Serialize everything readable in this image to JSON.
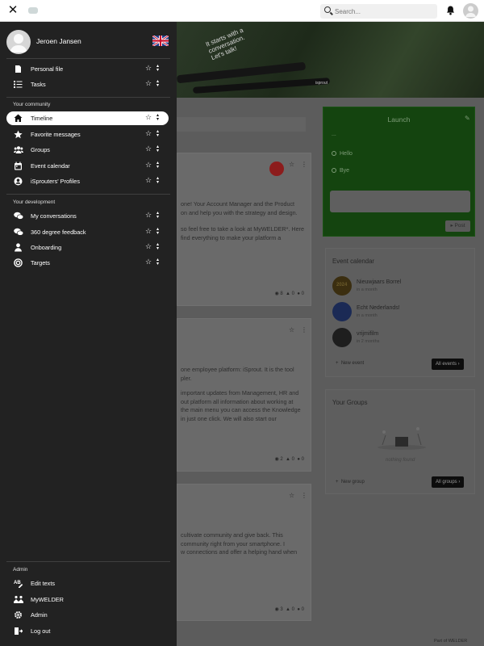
{
  "topbar": {
    "search_placeholder": "Search..."
  },
  "user": {
    "name": "Jeroen Jansen"
  },
  "nav_top": [
    {
      "label": "Personal file",
      "icon": "file-icon"
    },
    {
      "label": "Tasks",
      "icon": "tasks-icon"
    }
  ],
  "section_community": "Your community",
  "nav_community": [
    {
      "label": "Timeline",
      "icon": "home-icon",
      "active": true
    },
    {
      "label": "Favorite messages",
      "icon": "star-icon"
    },
    {
      "label": "Groups",
      "icon": "users-icon"
    },
    {
      "label": "Event calendar",
      "icon": "calendar-icon"
    },
    {
      "label": "iSprouters' Profiles",
      "icon": "profile-icon"
    }
  ],
  "section_development": "Your development",
  "nav_development": [
    {
      "label": "My conversations",
      "icon": "conversation-icon"
    },
    {
      "label": "360 degree feedback",
      "icon": "feedback-icon"
    },
    {
      "label": "Onboarding",
      "icon": "person-icon"
    },
    {
      "label": "Targets",
      "icon": "target-icon"
    }
  ],
  "section_admin": "Admin",
  "nav_admin": [
    {
      "label": "Edit texts",
      "icon": "edit-text-icon"
    },
    {
      "label": "MyWELDER",
      "icon": "welder-icon"
    },
    {
      "label": "Admin",
      "icon": "gear-icon"
    },
    {
      "label": "Log out",
      "icon": "logout-icon"
    }
  ],
  "hero": {
    "text_line1": "It starts with a",
    "text_line2": "conversation.",
    "text_line3": "Let's talk!",
    "brand": "isprout"
  },
  "feed": [
    {
      "lines": [
        "one! Your Account Manager and the Product",
        "on and help you with the strategy and design.",
        "",
        "so feel free to take a look at MyWELDER*. Here",
        "find everything to make your platform a"
      ],
      "views": "8",
      "likes": "0",
      "comments": "0"
    },
    {
      "lines": [
        "one employee platform: iSprout. It is the tool",
        "pler.",
        "",
        "important updates from Management, HR and",
        "out platform all information about working at",
        "the main menu you can access the Knowledge",
        "in just one click. We will also start our"
      ],
      "views": "2",
      "likes": "0",
      "comments": "0"
    },
    {
      "lines": [
        "cultivate community and give back. This",
        "community right from your smartphone. I",
        "w connections and offer a helping hand when"
      ],
      "views": "3",
      "likes": "0",
      "comments": "0"
    }
  ],
  "launch": {
    "title": "Launch",
    "dash": "...",
    "options": [
      "Hello",
      "Bye"
    ],
    "post_label": "Post"
  },
  "events": {
    "title": "Event calendar",
    "items": [
      {
        "name": "Nieuwjaars Borrel",
        "when": "in a month",
        "thumb_text": "2024"
      },
      {
        "name": "Echt Nederlands!",
        "when": "in a month",
        "thumb_text": ""
      },
      {
        "name": "vrijmifilm",
        "when": "in 2 months",
        "thumb_text": ""
      }
    ],
    "new_label": "New event",
    "all_label": "All events"
  },
  "groups": {
    "title": "Your Groups",
    "empty_label": "nothing found",
    "new_label": "New group",
    "all_label": "All groups"
  },
  "footer": {
    "text": "Part of WELDER"
  },
  "colors": {
    "drawer": "#222222",
    "launch_green": "#14440f",
    "active_pill": "#ffffff"
  }
}
